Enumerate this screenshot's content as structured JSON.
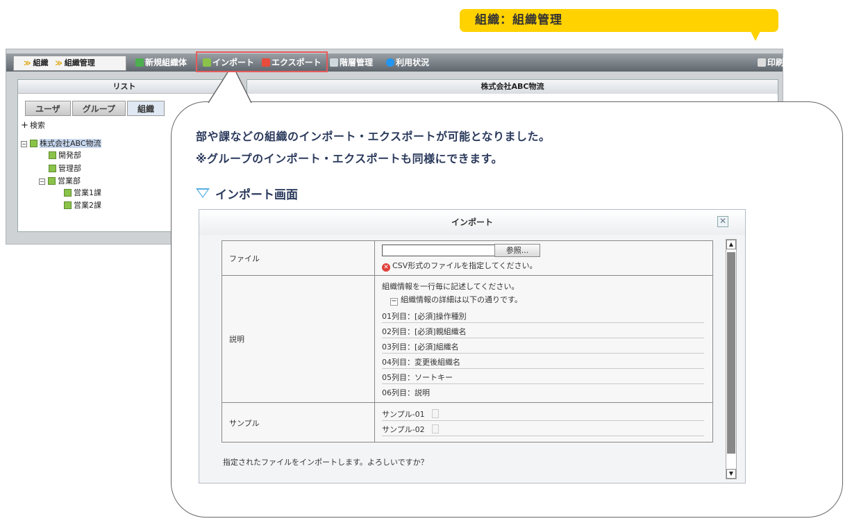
{
  "callout_tag": "組織：組織管理",
  "toolbar": {
    "breadcrumb_1": "組織",
    "breadcrumb_2": "組織管理",
    "new_org": "新規組織体",
    "import": "インポート",
    "export": "エクスポート",
    "hierarchy": "階層管理",
    "usage": "利用状況",
    "print": "印刷"
  },
  "left_panel": {
    "title": "リスト",
    "tabs": [
      "ユーザ",
      "グループ",
      "組織"
    ],
    "search": "検索",
    "tree": [
      "株式会社ABC物流",
      "開発部",
      "管理部",
      "営業部",
      "営業1課",
      "営業2課"
    ]
  },
  "right_panel": {
    "title": "株式会社ABC物流"
  },
  "message": {
    "line1": "部や課などの組織のインポート・エクスポートが可能となりました。",
    "line2": "※グループのインポート・エクスポートも同様にできます。",
    "subhead": "インポート画面"
  },
  "dialog": {
    "title": "インポート",
    "file_label": "ファイル",
    "browse_button": "参照...",
    "file_error": "CSV形式のファイルを指定してください。",
    "desc_label": "説明",
    "desc_intro": "組織情報を一行毎に記述してください。",
    "desc_detail": "組織情報の詳細は以下の通りです。",
    "columns": [
      "01列目：[必須]操作種別",
      "02列目：[必須]親組織名",
      "03列目：[必須]組織名",
      "04列目：変更後組織名",
      "05列目：ソートキー",
      "06列目：説明"
    ],
    "sample_label": "サンプル",
    "samples": [
      "サンプル-01",
      "サンプル-02"
    ],
    "confirm": "指定されたファイルをインポートします。よろしいですか？"
  },
  "colors": {
    "accent_yellow": "#ffd200",
    "highlight_red": "#e75a5a",
    "heading_navy": "#2b3a5c",
    "triangle_blue": "#5aaee0"
  }
}
